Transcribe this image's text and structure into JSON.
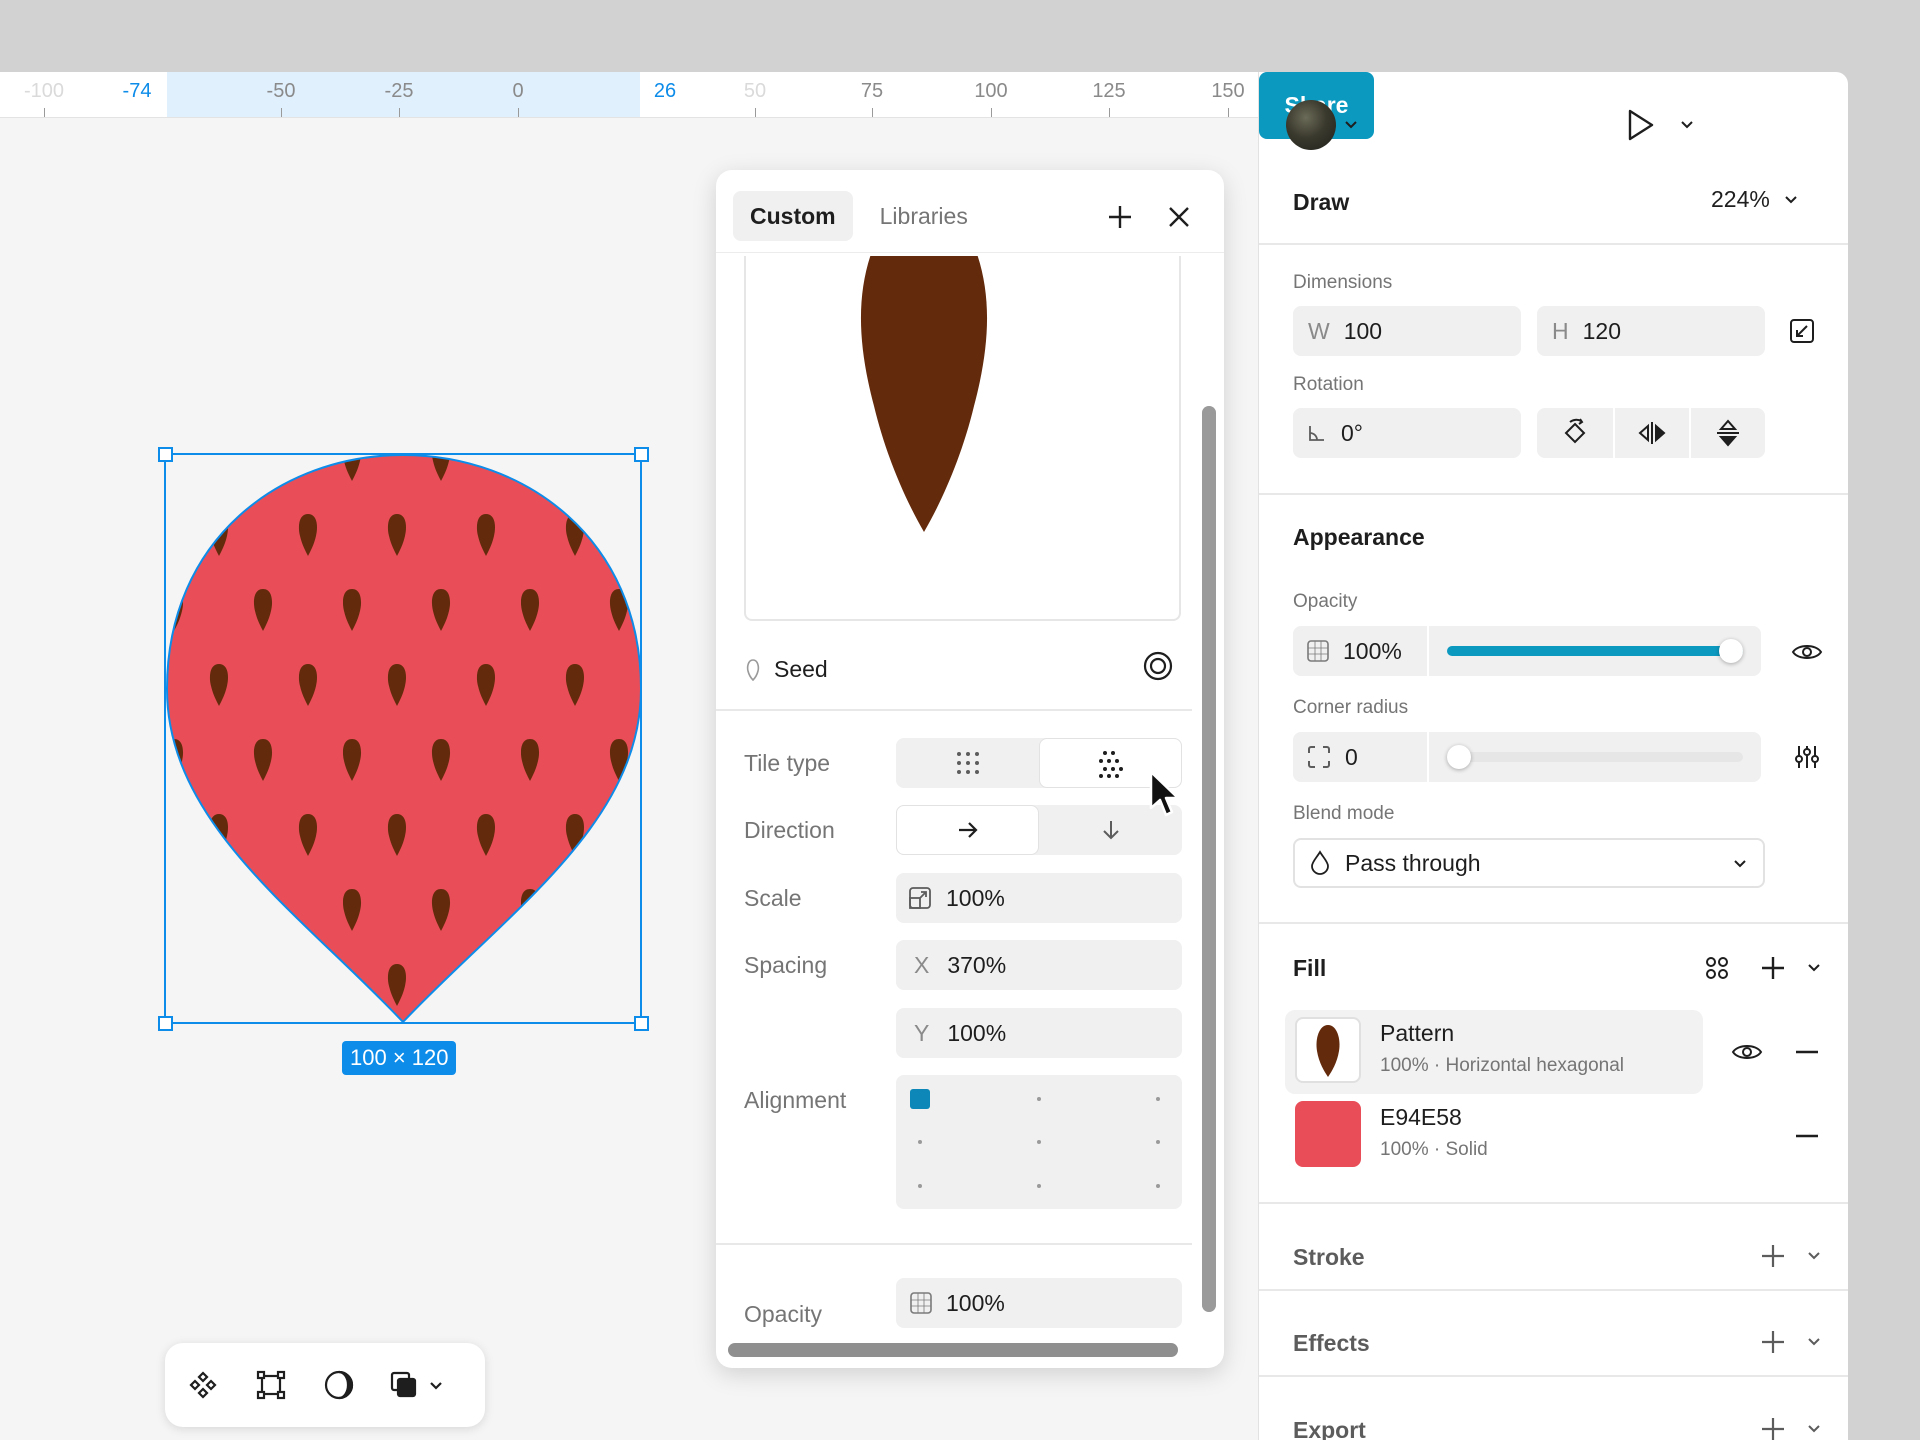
{
  "ruler": {
    "ticks": [
      "-100",
      "-74",
      "-50",
      "-25",
      "0",
      "26",
      "50",
      "75",
      "100",
      "125",
      "150"
    ]
  },
  "selection": {
    "size_label": "100 × 120"
  },
  "fill_panel": {
    "tabs": [
      "Custom",
      "Libraries"
    ],
    "source_name": "Seed",
    "tile_type_label": "Tile type",
    "direction_label": "Direction",
    "scale_label": "Scale",
    "scale_value": "100%",
    "spacing_label": "Spacing",
    "spacing_x_prefix": "X",
    "spacing_x": "370%",
    "spacing_y_prefix": "Y",
    "spacing_y": "100%",
    "alignment_label": "Alignment",
    "opacity_label": "Opacity",
    "opacity_value": "100%"
  },
  "header": {
    "share_label": "Share",
    "mode_label": "Draw",
    "zoom": "224%"
  },
  "dimensions": {
    "label": "Dimensions",
    "w_prefix": "W",
    "w": "100",
    "h_prefix": "H",
    "h": "120"
  },
  "rotation": {
    "label": "Rotation",
    "value": "0°"
  },
  "appearance": {
    "title": "Appearance",
    "opacity_label": "Opacity",
    "opacity_value": "100%",
    "opacity_level": 1.0,
    "corner_radius_label": "Corner radius",
    "corner_radius_value": "0",
    "corner_radius_level": 0.0,
    "blend_label": "Blend mode",
    "blend_value": "Pass through"
  },
  "fill": {
    "title": "Fill",
    "items": [
      {
        "name": "Pattern",
        "sub": "100% · Horizontal hexagonal"
      },
      {
        "name": "E94E58",
        "sub": "100% · Solid"
      }
    ]
  },
  "sections": {
    "stroke": "Stroke",
    "effects": "Effects",
    "export": "Export"
  },
  "colors": {
    "accent": "#0d8ce9",
    "share": "#0c99c0",
    "fill_red": "#E94E58",
    "seed_brown": "#642A0C"
  }
}
